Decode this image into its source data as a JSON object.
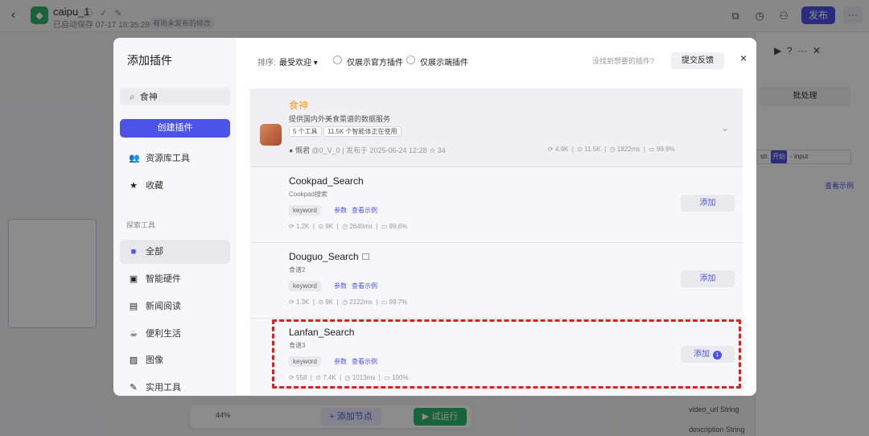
{
  "app": {
    "name": "caipu_1",
    "autosave": "已自动保存 07-17 18:35:28",
    "unpublished_badge": "有尚未发布的修改",
    "publish_label": "发布",
    "more_label": "···"
  },
  "right_panel": {
    "tab_label": "批处理",
    "input_tag_prefix": "str.",
    "input_tag_icon": "开始",
    "input_tag_value": "- input",
    "example_link": "查看示例",
    "field_video": "video_url  String",
    "field_desc": "description  String"
  },
  "bottom_toolbar": {
    "zoom": "44%",
    "add_node_label": "+ 添加节点",
    "test_run_label": "▶ 试运行"
  },
  "modal": {
    "title": "添加插件",
    "search_value": "食神",
    "create_label": "创建插件",
    "nav_top": [
      {
        "label": "资源库工具",
        "icon": "people-icon"
      },
      {
        "label": "收藏",
        "icon": "star-icon"
      }
    ],
    "section_label": "探索工具",
    "nav_explore": [
      {
        "label": "全部",
        "icon": "grid-icon",
        "active": true
      },
      {
        "label": "智能硬件",
        "icon": "chip-icon"
      },
      {
        "label": "新闻阅读",
        "icon": "book-icon"
      },
      {
        "label": "便利生活",
        "icon": "cup-icon"
      },
      {
        "label": "图像",
        "icon": "image-icon"
      },
      {
        "label": "实用工具",
        "icon": "wrench-icon"
      }
    ],
    "sort_label": "排序:",
    "sort_value": "最受欢迎 ▾",
    "filter_official": "仅展示官方插件",
    "filter_client": "仅展示端插件",
    "not_found": "没找到想要的插件?",
    "feedback_label": "提交反馈",
    "close_label": "×"
  },
  "featured_plugin": {
    "name": "食神",
    "description": "提供国内外美食菜谱的数据服务",
    "tools_chip": "5 个工具",
    "usage_chip": "11.5K 个智能体正在使用",
    "author": "慨君",
    "author_handle": "@0_V_0",
    "published": "发布于 2025-06-24 12:28",
    "stars": "34",
    "stats": {
      "runs": "4.9K",
      "calls": "11.5K",
      "latency": "1822ms",
      "success": "99.9%"
    }
  },
  "plugins": [
    {
      "name": "Cookpad_Search",
      "description": "Cookpad搜索",
      "keyword": "keyword",
      "params_link": "参数",
      "example_link": "查看示例",
      "stats": {
        "runs": "1.2K",
        "calls": "9K",
        "latency": "2640ms",
        "success": "99.6%"
      },
      "add_label": "添加",
      "added_count": ""
    },
    {
      "name": "Douguo_Search",
      "description": "食谱2",
      "keyword": "keyword",
      "params_link": "参数",
      "example_link": "查看示例",
      "stats": {
        "runs": "1.3K",
        "calls": "9K",
        "latency": "2122ms",
        "success": "99.7%"
      },
      "add_label": "添加",
      "added_count": ""
    },
    {
      "name": "Lanfan_Search",
      "description": "食谱3",
      "keyword": "keyword",
      "params_link": "参数",
      "example_link": "查看示例",
      "stats": {
        "runs": "558",
        "calls": "7.4K",
        "latency": "1013ms",
        "success": "100%"
      },
      "add_label": "添加",
      "added_count": "1"
    }
  ],
  "colors": {
    "accent": "#4d53e8",
    "featured_name": "#f29f2a",
    "highlight": "#e01e1e",
    "run_green": "#2fb46b"
  }
}
